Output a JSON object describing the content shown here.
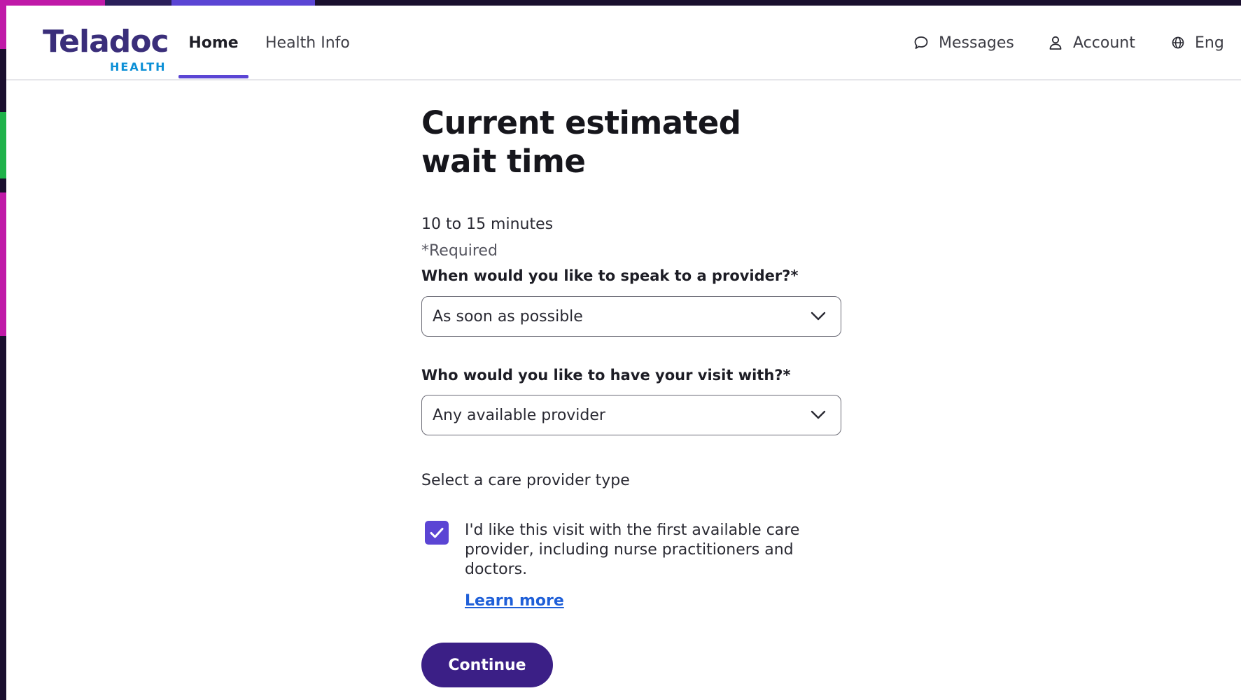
{
  "header": {
    "logo_word": "Teladoc",
    "logo_sub": "HEALTH",
    "nav": [
      {
        "label": "Home"
      },
      {
        "label": "Health Info"
      }
    ],
    "messages_label": "Messages",
    "account_label": "Account",
    "language_label": "Eng"
  },
  "main": {
    "title": "Current estimated wait time",
    "wait_time": "10 to 15 minutes",
    "required_note": "*Required",
    "when_label": "When would you like to speak to a provider?*",
    "when_value": "As soon as possible",
    "who_label": "Who would you like to have your visit with?*",
    "who_value": "Any available provider",
    "provider_type_label": "Select a care provider type",
    "checkbox_checked": true,
    "checkbox_text": "I'd like this visit with the first available care provider, including nurse practitioners and doctors.",
    "learn_more": "Learn more",
    "continue_label": "Continue"
  },
  "colors": {
    "accent": "#5b45d4",
    "button": "#3b1f86",
    "link": "#1f5fd8",
    "logo": "#3a2e7a"
  }
}
